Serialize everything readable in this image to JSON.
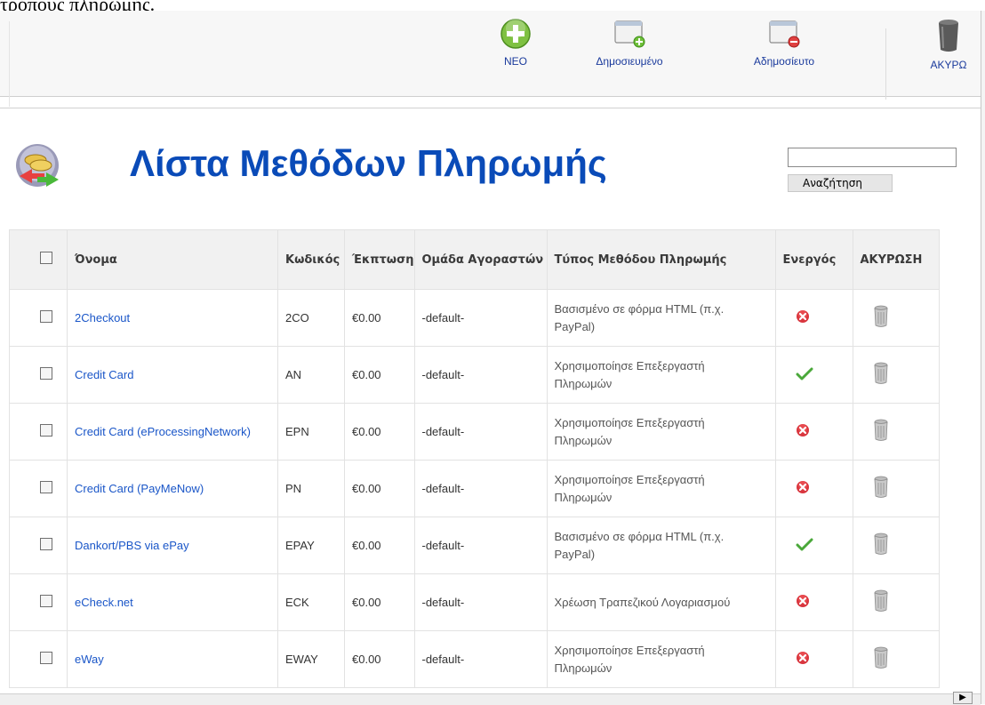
{
  "top_text": "τρόπους πληρωμής.",
  "toolbar": {
    "new_label": "ΝΕΟ",
    "publish_label": "Δημοσιευμένο",
    "unpublish_label": "Αδημοσίευτο",
    "cancel_label": "ΑΚΥΡΩ"
  },
  "page": {
    "title": "Λίστα Μεθόδων Πληρωμής"
  },
  "search": {
    "value": "",
    "button_label": "Αναζήτηση"
  },
  "table": {
    "headers": {
      "name": "Όνομα",
      "code": "Κωδικός",
      "discount": "Έκπτωση",
      "group": "Ομάδα Αγοραστών",
      "type": "Τύπος Μεθόδου Πληρωμής",
      "active": "Ενεργός",
      "cancel": "ΑΚΥΡΩΣΗ"
    },
    "rows": [
      {
        "name": "2Checkout",
        "code": "2CO",
        "discount": "€0.00",
        "group": "-default-",
        "type": "Βασισμένο σε φόρμα HTML (π.χ. PayPal)",
        "active": false
      },
      {
        "name": "Credit Card",
        "code": "AN",
        "discount": "€0.00",
        "group": "-default-",
        "type": "Χρησιμοποίησε Επεξεργαστή Πληρωμών",
        "active": true
      },
      {
        "name": "Credit Card (eProcessingNetwork)",
        "code": "EPN",
        "discount": "€0.00",
        "group": "-default-",
        "type": "Χρησιμοποίησε Επεξεργαστή Πληρωμών",
        "active": false
      },
      {
        "name": "Credit Card (PayMeNow)",
        "code": "PN",
        "discount": "€0.00",
        "group": "-default-",
        "type": "Χρησιμοποίησε Επεξεργαστή Πληρωμών",
        "active": false
      },
      {
        "name": "Dankort/PBS via ePay",
        "code": "EPAY",
        "discount": "€0.00",
        "group": "-default-",
        "type": "Βασισμένο σε φόρμα HTML (π.χ. PayPal)",
        "active": true
      },
      {
        "name": "eCheck.net",
        "code": "ECK",
        "discount": "€0.00",
        "group": "-default-",
        "type": "Χρέωση Τραπεζικού Λογαριασμού",
        "active": false
      },
      {
        "name": "eWay",
        "code": "EWAY",
        "discount": "€0.00",
        "group": "-default-",
        "type": "Χρησιμοποίησε Επεξεργαστή Πληρωμών",
        "active": false
      }
    ]
  },
  "colors": {
    "title": "#0a4bb8",
    "link": "#1a56c8",
    "inactive": "#d9363e",
    "active": "#4aa83a"
  }
}
